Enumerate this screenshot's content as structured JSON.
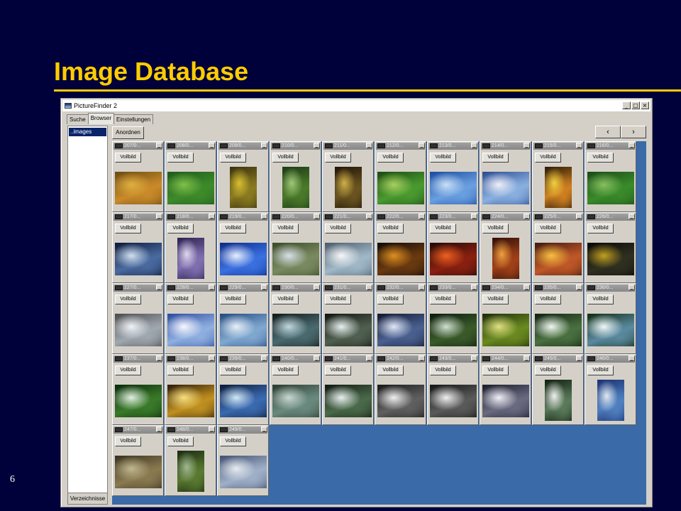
{
  "slide": {
    "title": "Image Database",
    "number": "6"
  },
  "window": {
    "title": "PictureFinder 2",
    "controls": [
      "_",
      "□",
      "×"
    ]
  },
  "tabs": [
    {
      "label": "Suche",
      "active": false
    },
    {
      "label": "Browser",
      "active": true
    },
    {
      "label": "Einstellungen",
      "active": false
    }
  ],
  "sidebar": {
    "items": [
      "..images"
    ],
    "button_label": "Verzeichnisse"
  },
  "toolbar": {
    "arrange_label": "Anordnen",
    "prev_label": "‹",
    "next_label": "›"
  },
  "thumbnail": {
    "full_label": "Vollbild",
    "minimize_label": "_"
  },
  "colors": {
    "title": "#ffcc00",
    "background": "#00003a",
    "browser_bg": "#3a6aa8"
  },
  "thumbnails": [
    {
      "label": "207/0...",
      "colors": [
        "#6b4a12",
        "#c98a2a",
        "#e0b040"
      ],
      "orient": "landscape"
    },
    {
      "label": "208/0...",
      "colors": [
        "#1f5a1c",
        "#3d8a2a",
        "#7fc04a"
      ],
      "orient": "landscape"
    },
    {
      "label": "209/0...",
      "colors": [
        "#3a3010",
        "#8a7a20",
        "#d8c030"
      ],
      "orient": "portrait"
    },
    {
      "label": "210/0...",
      "colors": [
        "#1c3a14",
        "#4a7a2a",
        "#a0c878"
      ],
      "orient": "portrait"
    },
    {
      "label": "211/0...",
      "colors": [
        "#201408",
        "#6a5420",
        "#d0b048"
      ],
      "orient": "portrait"
    },
    {
      "label": "212/0...",
      "colors": [
        "#1a4a12",
        "#4a9a30",
        "#a8d060"
      ],
      "orient": "landscape"
    },
    {
      "label": "213/0...",
      "colors": [
        "#1a4aa0",
        "#6aa0e0",
        "#c8e0f8"
      ],
      "orient": "landscape"
    },
    {
      "label": "214/0...",
      "colors": [
        "#2a4a90",
        "#8ab0e0",
        "#f0f0f8"
      ],
      "orient": "landscape"
    },
    {
      "label": "215/0...",
      "colors": [
        "#2a1a08",
        "#d08020",
        "#f0d040"
      ],
      "orient": "portrait"
    },
    {
      "label": "216/0...",
      "colors": [
        "#1a4a18",
        "#3a8a2a",
        "#88c060"
      ],
      "orient": "landscape"
    },
    {
      "label": "217/0...",
      "colors": [
        "#0a1838",
        "#4a6aa0",
        "#d0e0f0"
      ],
      "orient": "landscape"
    },
    {
      "label": "218/0...",
      "colors": [
        "#2a2050",
        "#8070b0",
        "#e0d8f0"
      ],
      "orient": "portrait"
    },
    {
      "label": "219/0...",
      "colors": [
        "#0a2a8a",
        "#3a70e0",
        "#e8f0ff"
      ],
      "orient": "landscape"
    },
    {
      "label": "220/0...",
      "colors": [
        "#3a4a28",
        "#7a8a60",
        "#d8e0e8"
      ],
      "orient": "landscape"
    },
    {
      "label": "221/0...",
      "colors": [
        "#4a5a6a",
        "#a0b8c8",
        "#f8f8f8"
      ],
      "orient": "landscape"
    },
    {
      "label": "222/0...",
      "colors": [
        "#100808",
        "#6a3a10",
        "#e09020"
      ],
      "orient": "landscape"
    },
    {
      "label": "223/0...",
      "colors": [
        "#200808",
        "#8a2010",
        "#f06020"
      ],
      "orient": "landscape"
    },
    {
      "label": "224/0...",
      "colors": [
        "#301008",
        "#a04018",
        "#f0a040"
      ],
      "orient": "portrait"
    },
    {
      "label": "225/0...",
      "colors": [
        "#401810",
        "#c05828",
        "#f8c040"
      ],
      "orient": "landscape"
    },
    {
      "label": "226/0...",
      "colors": [
        "#080808",
        "#303020",
        "#c0a020"
      ],
      "orient": "landscape"
    },
    {
      "label": "227/0...",
      "colors": [
        "#4a4a4a",
        "#a0a8b0",
        "#f0f4f8"
      ],
      "orient": "landscape"
    },
    {
      "label": "228/0...",
      "colors": [
        "#2a4aa0",
        "#90b0e0",
        "#f8f8ff"
      ],
      "orient": "landscape"
    },
    {
      "label": "229/0...",
      "colors": [
        "#204a80",
        "#80a8d0",
        "#e8f0f8"
      ],
      "orient": "landscape"
    },
    {
      "label": "230/0...",
      "colors": [
        "#101818",
        "#4a6a70",
        "#c0d8e0"
      ],
      "orient": "landscape"
    },
    {
      "label": "231/0...",
      "colors": [
        "#101410",
        "#506050",
        "#e8f0f0"
      ],
      "orient": "landscape"
    },
    {
      "label": "232/0...",
      "colors": [
        "#101830",
        "#4a6090",
        "#e0e8f8"
      ],
      "orient": "landscape"
    },
    {
      "label": "233/0...",
      "colors": [
        "#0a1a0a",
        "#3a5a2a",
        "#d0e0d0"
      ],
      "orient": "landscape"
    },
    {
      "label": "234/0...",
      "colors": [
        "#1a2a0a",
        "#6a8a20",
        "#e0e080"
      ],
      "orient": "landscape"
    },
    {
      "label": "235/0...",
      "colors": [
        "#102010",
        "#4a7040",
        "#f0f8f0"
      ],
      "orient": "landscape"
    },
    {
      "label": "236/0...",
      "colors": [
        "#102a10",
        "#5a8aa0",
        "#f0f8f8"
      ],
      "orient": "landscape"
    },
    {
      "label": "237/0...",
      "colors": [
        "#0a2a0a",
        "#3a7a2a",
        "#e0f0e0"
      ],
      "orient": "landscape"
    },
    {
      "label": "238/0...",
      "colors": [
        "#2a1a08",
        "#c09020",
        "#f8e080"
      ],
      "orient": "landscape"
    },
    {
      "label": "239/0...",
      "colors": [
        "#0a1a3a",
        "#3a6ab0",
        "#d0e8f8"
      ],
      "orient": "landscape"
    },
    {
      "label": "240/0...",
      "colors": [
        "#2a3a30",
        "#6a8a80",
        "#c8d8d0"
      ],
      "orient": "landscape"
    },
    {
      "label": "241/0...",
      "colors": [
        "#101810",
        "#4a6a4a",
        "#e8f0f0"
      ],
      "orient": "landscape"
    },
    {
      "label": "242/0...",
      "colors": [
        "#181818",
        "#606060",
        "#f0f0f0"
      ],
      "orient": "landscape"
    },
    {
      "label": "243/0...",
      "colors": [
        "#141414",
        "#5a5a5a",
        "#f0f0f0"
      ],
      "orient": "landscape"
    },
    {
      "label": "244/0...",
      "colors": [
        "#1a1a2a",
        "#6a6a80",
        "#f0f0f8"
      ],
      "orient": "landscape"
    },
    {
      "label": "245/0...",
      "colors": [
        "#102010",
        "#5a7a5a",
        "#f0f0f0"
      ],
      "orient": "portrait"
    },
    {
      "label": "246/0...",
      "colors": [
        "#1a3070",
        "#5080c0",
        "#e0e8f0"
      ],
      "orient": "portrait"
    },
    {
      "label": "247/0...",
      "colors": [
        "#3a3020",
        "#8a7a50",
        "#c0b890"
      ],
      "orient": "landscape"
    },
    {
      "label": "248/0...",
      "colors": [
        "#1a2a10",
        "#5a7a30",
        "#a0b890"
      ],
      "orient": "portrait"
    },
    {
      "label": "249/0...",
      "colors": [
        "#405070",
        "#a0b0c8",
        "#e8ecf0"
      ],
      "orient": "landscape"
    }
  ]
}
